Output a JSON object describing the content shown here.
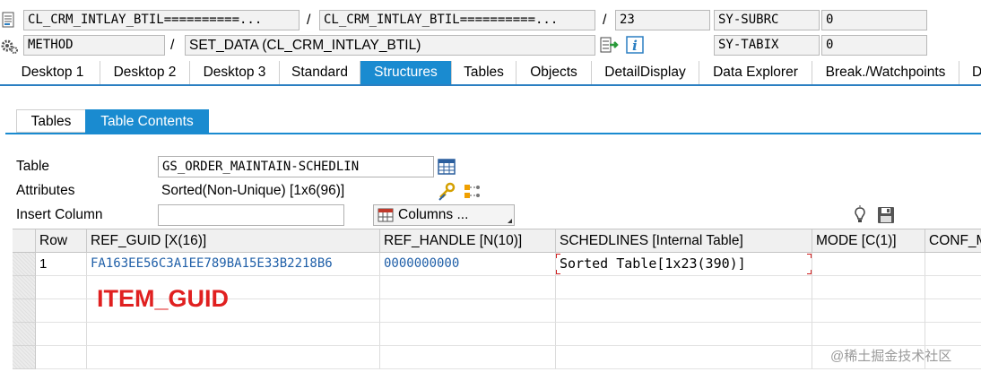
{
  "header": {
    "row1": {
      "program": "CL_CRM_INTLAY_BTIL==========...",
      "include": "CL_CRM_INTLAY_BTIL==========...",
      "line": "23",
      "sysvar": "SY-SUBRC",
      "sysval": "0"
    },
    "row2": {
      "type": "METHOD",
      "name": "SET_DATA (CL_CRM_INTLAY_BTIL)",
      "sysvar": "SY-TABIX",
      "sysval": "0"
    },
    "slash": "/"
  },
  "tabs": [
    "Desktop 1",
    "Desktop 2",
    "Desktop 3",
    "Standard",
    "Structures",
    "Tables",
    "Objects",
    "DetailDisplay",
    "Data Explorer",
    "Break./Watchpoints",
    "D"
  ],
  "active_tab": "Structures",
  "subtabs": [
    "Tables",
    "Table Contents"
  ],
  "active_subtab": "Table Contents",
  "form": {
    "table_label": "Table",
    "table_value": "GS_ORDER_MAINTAIN-SCHEDLIN",
    "attributes_label": "Attributes",
    "attributes_value": "Sorted(Non-Unique) [1x6(96)]",
    "insert_label": "Insert Column",
    "insert_value": "",
    "columns_button": "Columns ..."
  },
  "grid": {
    "columns": [
      "Row",
      "REF_GUID [X(16)]",
      "REF_HANDLE [N(10)]",
      "SCHEDLINES [Internal Table]",
      "MODE [C(1)]",
      "CONF_M"
    ],
    "rows": [
      [
        "1",
        "FA163EE56C3A1EE789BA15E33B2218B6",
        "0000000000",
        "Sorted Table[1x23(390)]",
        "",
        ""
      ]
    ]
  },
  "annotation": "ITEM_GUID",
  "watermark": "@稀土掘金技术社区",
  "colors": {
    "accent": "#1a8bd0",
    "annotation": "#e02020",
    "guid_text": "#1f5fa8"
  }
}
